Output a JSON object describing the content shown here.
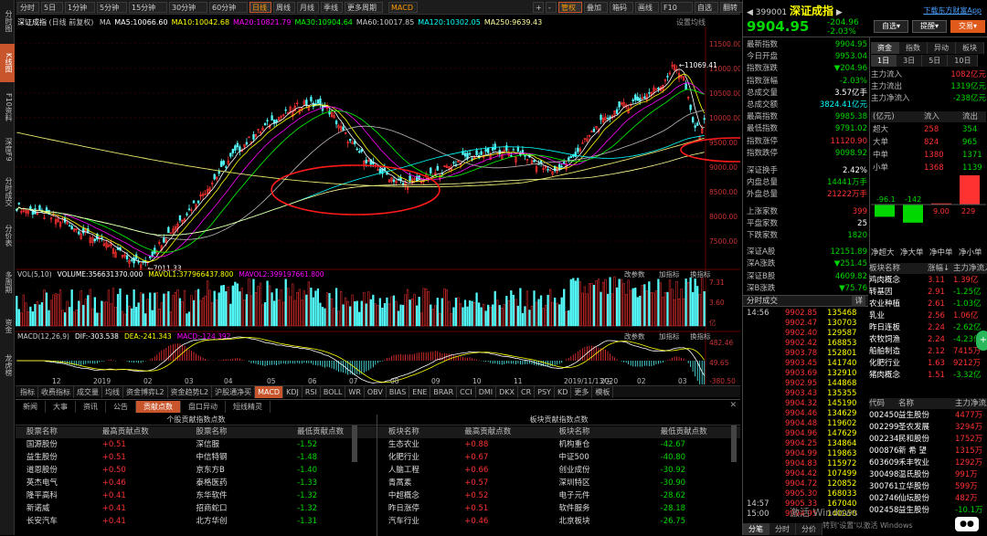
{
  "left_nav": [
    {
      "label": "分时图",
      "active": false
    },
    {
      "label": "K线图",
      "active": true
    },
    {
      "label": "F10资料",
      "active": false
    },
    {
      "label": "深度F9",
      "active": false
    },
    {
      "label": "分时成交",
      "active": false
    },
    {
      "label": "分价表",
      "active": false
    },
    {
      "label": "多周期",
      "active": false
    },
    {
      "label": "资金",
      "active": false
    },
    {
      "label": "龙虎榜",
      "active": false
    }
  ],
  "period_tabs": [
    "分时",
    "5日",
    "1分钟",
    "5分钟",
    "15分钟",
    "30分钟",
    "60分钟",
    "日线",
    "周线",
    "月线",
    "季线",
    "更多周期"
  ],
  "period_active": "日线",
  "indicator_btn": "MACD",
  "toolbar_right": [
    "+",
    "-",
    "管权",
    "叠加",
    "箱码",
    "画线",
    "F10",
    "自选",
    "翻转",
    "移动",
    "简约",
    "隐藏"
  ],
  "chart_title": "深证成指",
  "chart_subtitle": "(日线 前复权)",
  "ma_legend": [
    {
      "text": "MA",
      "color": "#cccccc"
    },
    {
      "text": "MA5:10066.60",
      "color": "#ffffff"
    },
    {
      "text": "MA10:10042.68",
      "color": "#ffff00"
    },
    {
      "text": "MA20:10821.79",
      "color": "#ff00ff"
    },
    {
      "text": "MA30:10904.64",
      "color": "#00ff00"
    },
    {
      "text": "MA60:10017.85",
      "color": "#cccccc"
    },
    {
      "text": "MA120:10302.05",
      "color": "#00ffff"
    },
    {
      "text": "MA250:9639.43",
      "color": "#ffff99"
    }
  ],
  "chart_setting": "设置均线",
  "price_axis": [
    "11500.00",
    "11000.00",
    "10500.00",
    "10000.00",
    "9500.00",
    "9000.00",
    "8500.00",
    "8000.00",
    "7500.00"
  ],
  "high_label": "11069.41",
  "low_label": "7011.33",
  "vol_legend": [
    {
      "text": "VOL(5,10)",
      "color": "#cccccc"
    },
    {
      "text": "VOLUME:356631370.000",
      "color": "#ffffff"
    },
    {
      "text": "MAVOL1:377966437.800",
      "color": "#ffff00"
    },
    {
      "text": "MAVOL2:399197661.800",
      "color": "#ff00ff"
    }
  ],
  "vol_ctrl": [
    "改参数",
    "加指标",
    "换指标"
  ],
  "vol_axis": [
    "7.31",
    "3.60",
    "亿"
  ],
  "macd_legend": [
    {
      "text": "MACD(12,26,9)",
      "color": "#cccccc"
    },
    {
      "text": "DIF:-303.538",
      "color": "#ffffff"
    },
    {
      "text": "DEA:-241.343",
      "color": "#ffff00"
    },
    {
      "text": "MACD:-124.392",
      "color": "#ff00ff"
    }
  ],
  "macd_axis": [
    "482.46",
    "49.65",
    "-380.50"
  ],
  "time_axis": [
    "12",
    "2019",
    "02",
    "03",
    "04",
    "05",
    "06",
    "07",
    "08",
    "09",
    "10",
    "11",
    "2019/11/13/三",
    "2020",
    "02",
    "03"
  ],
  "indicator_tabs": [
    "指标",
    "收费指标",
    "成交量",
    "均线",
    "资金博弈L2",
    "资金趋势L2",
    "沪股通净买",
    "MACD",
    "KDJ",
    "RSI",
    "BOLL",
    "WR",
    "OBV",
    "BIAS",
    "ENE",
    "BRAR",
    "CCI",
    "DMI",
    "DKX",
    "CR",
    "PSY",
    "KD",
    "更多",
    "模板"
  ],
  "bottom_tabs": [
    "新闻",
    "大事",
    "资讯",
    "公告",
    "贡献点数",
    "盘口异动",
    "短线精灵"
  ],
  "bottom_tab_active": "贡献点数",
  "stock_section_title": "个股贡献指数点数",
  "sector_section_title": "板块贡献指数点数",
  "stock_table": {
    "headers": [
      "股票名称",
      "最高贡献点数",
      "股票名称",
      "最低贡献点数"
    ],
    "rows": [
      [
        "国源股份",
        "+0.51",
        "深信服",
        "-1.52"
      ],
      [
        "益生股份",
        "+0.51",
        "中信特钢",
        "-1.48"
      ],
      [
        "道恩股份",
        "+0.50",
        "京东方B",
        "-1.40"
      ],
      [
        "英杰电气",
        "+0.46",
        "泰格医药",
        "-1.33"
      ],
      [
        "隆平高科",
        "+0.41",
        "东华软件",
        "-1.32"
      ],
      [
        "新诺威",
        "+0.41",
        "招商蛇口",
        "-1.32"
      ],
      [
        "长安汽车",
        "+0.41",
        "北方华创",
        "-1.31"
      ]
    ]
  },
  "sector_table": {
    "headers": [
      "板块名称",
      "最高贡献点数",
      "板块名称",
      "最低贡献点数"
    ],
    "rows": [
      [
        "生态农业",
        "+0.88",
        "机构重仓",
        "-42.67"
      ],
      [
        "化肥行业",
        "+0.67",
        "中证500",
        "-40.80"
      ],
      [
        "人脑工程",
        "+0.66",
        "创业成份",
        "-30.92"
      ],
      [
        "青蒿素",
        "+0.57",
        "深圳特区",
        "-30.90"
      ],
      [
        "中超概念",
        "+0.52",
        "电子元件",
        "-28.62"
      ],
      [
        "昨日涨停",
        "+0.51",
        "软件服务",
        "-28.18"
      ],
      [
        "汽车行业",
        "+0.46",
        "北京板块",
        "-26.75"
      ]
    ]
  },
  "quote": {
    "code": "399001",
    "name": "深证成指",
    "download_link": "下载东方财富App",
    "price": "9904.95",
    "change": "-204.96",
    "change_pct": "-2.03%",
    "btn_watch": "自选",
    "btn_alert": "提醒",
    "btn_trade": "交易",
    "stats": [
      {
        "label": "最新指数",
        "value": "9904.95",
        "color": "#00d800"
      },
      {
        "label": "今日开盘",
        "value": "9953.04",
        "color": "#00d800"
      },
      {
        "label": "指数涨跌",
        "value": "▼204.96",
        "color": "#00d800"
      },
      {
        "label": "指数涨幅",
        "value": "-2.03%",
        "color": "#00d800"
      },
      {
        "label": "总成交量",
        "value": "3.57亿手",
        "color": "#ffffff"
      },
      {
        "label": "总成交额",
        "value": "3824.41亿元",
        "color": "#00ffff"
      },
      {
        "label": "最高指数",
        "value": "9985.38",
        "color": "#00d800"
      },
      {
        "label": "最低指数",
        "value": "9791.02",
        "color": "#00d800"
      },
      {
        "label": "指数涨停",
        "value": "11120.90",
        "color": "#ff3232"
      },
      {
        "label": "指数跌停",
        "value": "9098.92",
        "color": "#00d800"
      },
      {
        "label": "深证换手",
        "value": "2.42%",
        "color": "#ffffff"
      },
      {
        "label": "内盘总量",
        "value": "14441万手",
        "color": "#00d800"
      },
      {
        "label": "外盘总量",
        "value": "21222万手",
        "color": "#ff3232"
      },
      {
        "label": "上涨家数",
        "value": "399",
        "color": "#ff3232"
      },
      {
        "label": "平盘家数",
        "value": "25",
        "color": "#ffffff"
      },
      {
        "label": "下跌家数",
        "value": "1820",
        "color": "#00d800"
      },
      {
        "label": "深证A股",
        "value": "12151.89",
        "color": "#00d800"
      },
      {
        "label": "深A涨跌",
        "value": "▼251.45",
        "color": "#00d800"
      },
      {
        "label": "深证B股",
        "value": "4609.82",
        "color": "#00d800"
      },
      {
        "label": "深B涨跌",
        "value": "▼75.76",
        "color": "#00d800"
      }
    ]
  },
  "fund_tabs": [
    "资金",
    "指数",
    "异动",
    "板块"
  ],
  "fund_period_tabs": [
    "1日",
    "3日",
    "5日",
    "10日"
  ],
  "fund_flow": [
    {
      "label": "主力流入",
      "value": "1082亿元",
      "color": "#ff3232"
    },
    {
      "label": "主力流出",
      "value": "1319亿元",
      "color": "#00d800"
    },
    {
      "label": "主力净流入",
      "value": "-238亿元",
      "color": "#00d800"
    }
  ],
  "fund_table_headers": [
    "(亿元)",
    "流入",
    "流出"
  ],
  "fund_table": [
    [
      "超大",
      "258",
      "354"
    ],
    [
      "大单",
      "824",
      "965"
    ],
    [
      "中单",
      "1380",
      "1371"
    ],
    [
      "小单",
      "1368",
      "1139"
    ]
  ],
  "fund_bars": [
    {
      "label": "-96.1",
      "value": -96.1
    },
    {
      "label": "-142",
      "value": -142
    },
    {
      "label": "9.00",
      "value": 9.0
    },
    {
      "label": "229",
      "value": 229
    }
  ],
  "fund_bar_names": [
    "净超大",
    "净大单",
    "净中单",
    "净小单"
  ],
  "concept_headers": [
    "板块名称",
    "涨幅↓",
    "主力净流入"
  ],
  "concept_rows": [
    [
      "鸡肉概念",
      "3.11",
      "1.39亿"
    ],
    [
      "转基因",
      "2.91",
      "-1.25亿"
    ],
    [
      "农业种植",
      "2.61",
      "-1.03亿"
    ],
    [
      "乳业",
      "2.56",
      "1.06亿"
    ],
    [
      "昨日连板",
      "2.24",
      "-2.62亿"
    ],
    [
      "农牧饲渔",
      "2.24",
      "-4.23亿"
    ],
    [
      "船舶制造",
      "2.12",
      "7415万"
    ],
    [
      "化肥行业",
      "1.63",
      "9212万"
    ],
    [
      "猪肉概念",
      "1.51",
      "-3.32亿"
    ]
  ],
  "leader_headers": [
    "代码",
    "名称",
    "主力净流入"
  ],
  "leader_rows": [
    [
      "002450",
      "益生股份",
      "4477万"
    ],
    [
      "002299",
      "圣农发展",
      "3294万"
    ],
    [
      "002234",
      "民和股份",
      "1752万"
    ],
    [
      "000876",
      "新 希 望",
      "1315万"
    ],
    [
      "603609",
      "禾丰牧业",
      "1292万"
    ],
    [
      "300498",
      "温氏股份",
      "991万"
    ],
    [
      "300761",
      "立华股份",
      "599万"
    ],
    [
      "002746",
      "仙坛股份",
      "482万"
    ],
    [
      "002458",
      "益生股份",
      "-10.1万"
    ]
  ],
  "ticks_header": "分时成交",
  "ticks_btn": "详",
  "ticks": [
    [
      "14:56",
      "9902.85",
      "135468"
    ],
    [
      "",
      "9902.47",
      "130703"
    ],
    [
      "",
      "9902.40",
      "129587"
    ],
    [
      "",
      "9902.42",
      "168853"
    ],
    [
      "",
      "9903.78",
      "152801"
    ],
    [
      "",
      "9903.45",
      "141740"
    ],
    [
      "",
      "9903.69",
      "132910"
    ],
    [
      "",
      "9902.95",
      "144868"
    ],
    [
      "",
      "9903.43",
      "135355"
    ],
    [
      "",
      "9904.32",
      "145190"
    ],
    [
      "",
      "9904.46",
      "134629"
    ],
    [
      "",
      "9904.48",
      "119602"
    ],
    [
      "",
      "9904.96",
      "147629"
    ],
    [
      "",
      "9904.25",
      "134864"
    ],
    [
      "",
      "9904.99",
      "119863"
    ],
    [
      "",
      "9904.83",
      "115972"
    ],
    [
      "",
      "9904.42",
      "107499"
    ],
    [
      "",
      "9904.72",
      "120852"
    ],
    [
      "",
      "9905.30",
      "168033"
    ],
    [
      "14:57",
      "9905.33",
      "167040"
    ],
    [
      "15:00",
      "9904.95",
      "140950"
    ]
  ],
  "bottom_right_tabs": [
    "分笔",
    "分时",
    "分价"
  ],
  "watermark": "激活 Windows",
  "watermark_sub": "转到'设置'以激活 Windows"
}
